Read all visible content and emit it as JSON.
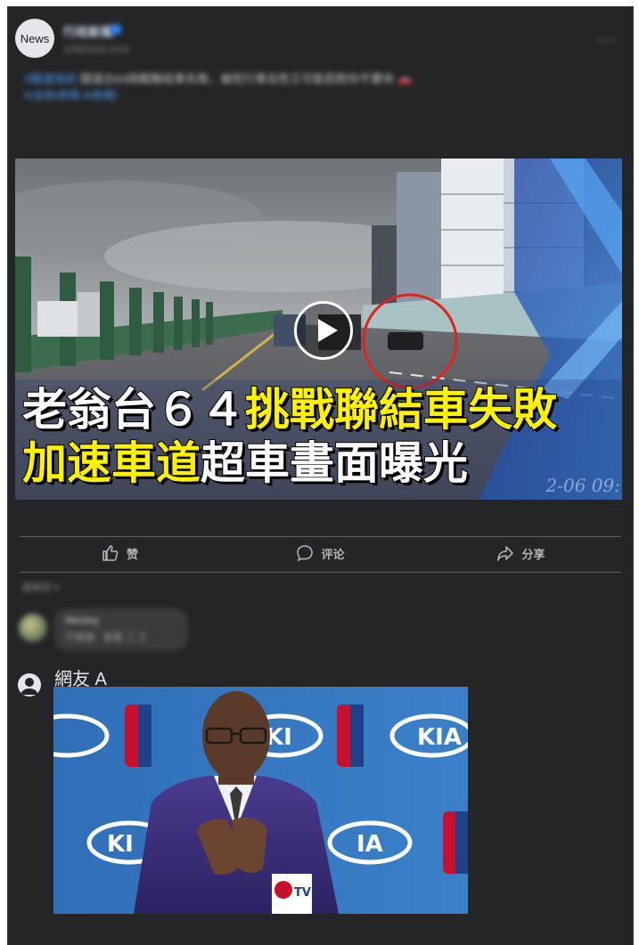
{
  "post": {
    "avatar_label": "News",
    "page_name": "行政新聞",
    "time_text": "1/26/2022 4:43 · ",
    "post_tag": "#國道快訊",
    "post_body": "  國道台64挑戰聯結車失敗，被控行車自危又可能罰款你不要命 🚗",
    "post_link": "#(全部)新聞 #(新聞)"
  },
  "video": {
    "headline_line1_white": "老翁台６４",
    "headline_line1_yellow": "挑戰聯結車失敗",
    "headline_line2_yellow": "加速車道",
    "headline_line2_white": "超車畫面曝光",
    "timestamp": "2-06 09:"
  },
  "actions": {
    "like": "赞",
    "comment": "评论",
    "share": "分享"
  },
  "comments": {
    "sort_label": "最相关 ▾",
    "blurred_name": "Wesley",
    "blurred_text": "不建議 · 查看 二 三",
    "user_name": "網友 A"
  },
  "photo": {
    "podium_logo": "TV"
  },
  "colors": {
    "card_bg": "#242526",
    "headline_yellow": "#fff200",
    "text_primary": "#e4e6eb"
  }
}
